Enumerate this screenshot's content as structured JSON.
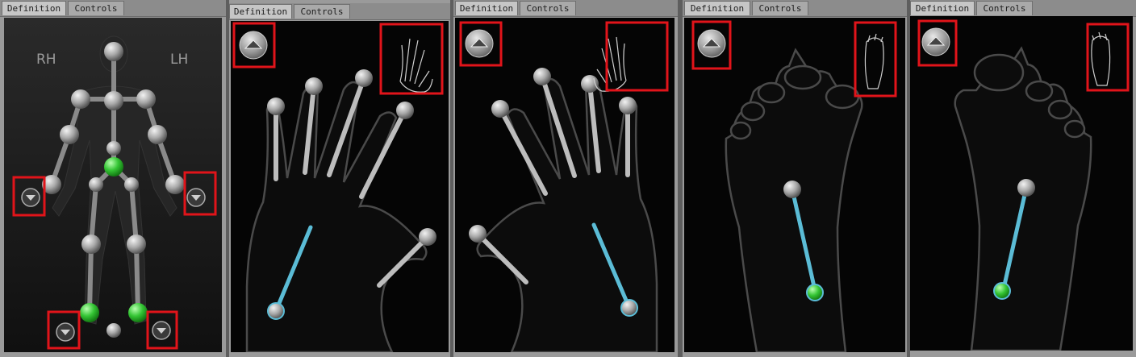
{
  "tabs": {
    "definition": "Definition",
    "controls": "Controls"
  },
  "body_panel": {
    "right_hand_label": "RH",
    "left_hand_label": "LH"
  },
  "colors": {
    "highlight_box": "#e1141a",
    "selected_bone": "#5bbcd6",
    "active_joint": "#3fc93f"
  },
  "panels": [
    {
      "id": "full-body",
      "view": "body-controls"
    },
    {
      "id": "right-hand",
      "view": "right-hand-fingers"
    },
    {
      "id": "left-hand",
      "view": "left-hand-fingers"
    },
    {
      "id": "right-foot",
      "view": "right-foot-toes"
    },
    {
      "id": "left-foot",
      "view": "left-foot-toes"
    }
  ]
}
